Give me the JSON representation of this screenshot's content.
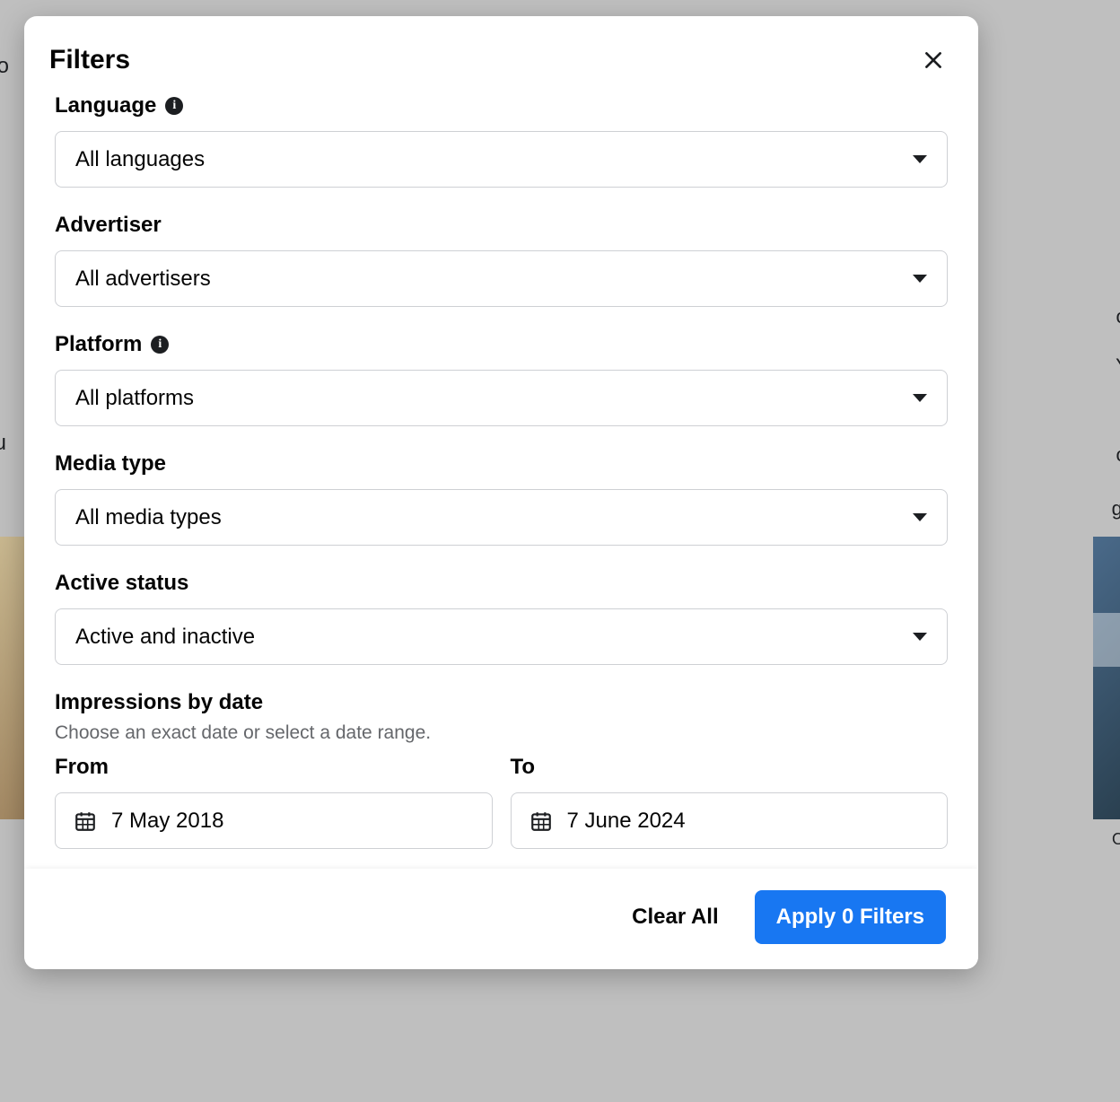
{
  "modal": {
    "title": "Filters",
    "filters": {
      "language": {
        "label": "Language",
        "value": "All languages",
        "has_info": true
      },
      "advertiser": {
        "label": "Advertiser",
        "value": "All advertisers",
        "has_info": false
      },
      "platform": {
        "label": "Platform",
        "value": "All platforms",
        "has_info": true
      },
      "media_type": {
        "label": "Media type",
        "value": "All media types",
        "has_info": false
      },
      "active_status": {
        "label": "Active status",
        "value": "Active and inactive",
        "has_info": false
      }
    },
    "impressions": {
      "label": "Impressions by date",
      "helper": "Choose an exact date or select a date range.",
      "from_label": "From",
      "to_label": "To",
      "from_value": "7 May 2018",
      "to_value": "7 June 2024"
    },
    "footer": {
      "clear_label": "Clear All",
      "apply_label": "Apply 0 Filters"
    }
  }
}
